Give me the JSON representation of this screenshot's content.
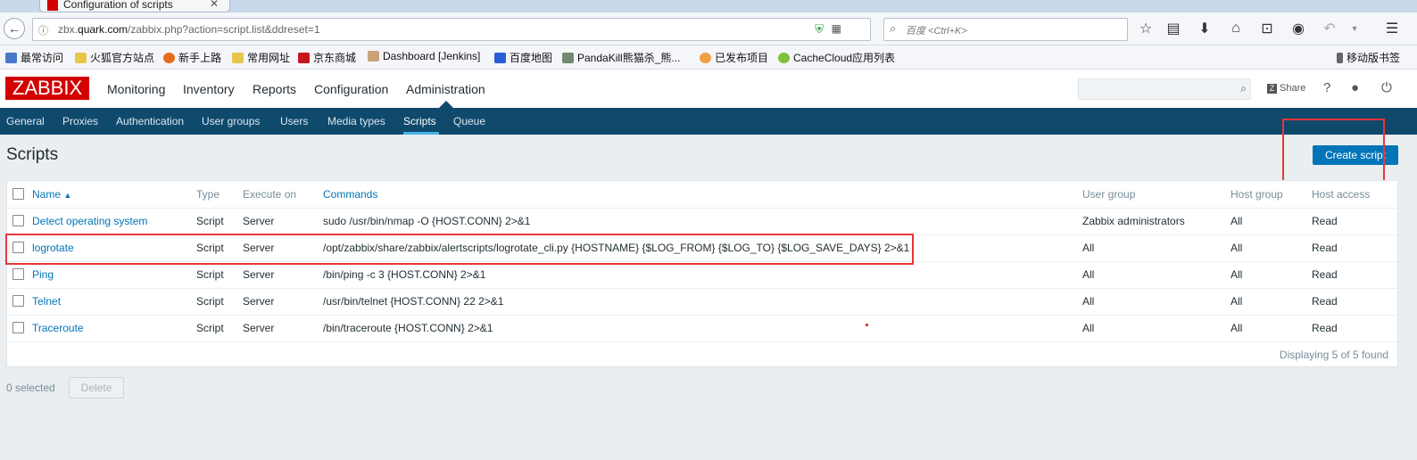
{
  "browser": {
    "tab_title": "Configuration of scripts",
    "url_domain": "zbx.quark.com",
    "url_prefix": "zbx.",
    "url_host": "quark.com",
    "url_path": "/zabbix.php?action=script.list&ddreset=1",
    "search_placeholder": "百度 <Ctrl+K>",
    "bookmarks": [
      "最常访问",
      "火狐官方站点",
      "新手上路",
      "常用网址",
      "京东商城",
      "Dashboard [Jenkins]",
      "百度地图",
      "PandaKill熊猫杀_熊...",
      "已发布项目",
      "CacheCloud应用列表",
      "移动版书签"
    ]
  },
  "zabbix": {
    "logo": "ZABBIX",
    "main_nav": [
      "Monitoring",
      "Inventory",
      "Reports",
      "Configuration",
      "Administration"
    ],
    "share_label": "Share",
    "sub_nav": [
      "General",
      "Proxies",
      "Authentication",
      "User groups",
      "Users",
      "Media types",
      "Scripts",
      "Queue"
    ],
    "active_sub": "Scripts"
  },
  "page": {
    "title": "Scripts",
    "create_button": "Create script",
    "table": {
      "headers": {
        "name": "Name",
        "sort_arrow": "▲",
        "type": "Type",
        "execute_on": "Execute on",
        "commands": "Commands",
        "user_group": "User group",
        "host_group": "Host group",
        "host_access": "Host access"
      },
      "rows": [
        {
          "name": "Detect operating system",
          "type": "Script",
          "execute_on": "Server",
          "commands": "sudo /usr/bin/nmap -O {HOST.CONN} 2>&1",
          "user_group": "Zabbix administrators",
          "host_group": "All",
          "host_access": "Read"
        },
        {
          "name": "logrotate",
          "type": "Script",
          "execute_on": "Server",
          "commands": "/opt/zabbix/share/zabbix/alertscripts/logrotate_cli.py {HOSTNAME} {$LOG_FROM} {$LOG_TO} {$LOG_SAVE_DAYS} 2>&1",
          "user_group": "All",
          "host_group": "All",
          "host_access": "Read"
        },
        {
          "name": "Ping",
          "type": "Script",
          "execute_on": "Server",
          "commands": "/bin/ping -c 3 {HOST.CONN} 2>&1",
          "user_group": "All",
          "host_group": "All",
          "host_access": "Read"
        },
        {
          "name": "Telnet",
          "type": "Script",
          "execute_on": "Server",
          "commands": "/usr/bin/telnet {HOST.CONN} 22 2>&1",
          "user_group": "All",
          "host_group": "All",
          "host_access": "Read"
        },
        {
          "name": "Traceroute",
          "type": "Script",
          "execute_on": "Server",
          "commands": "/bin/traceroute {HOST.CONN} 2>&1",
          "user_group": "All",
          "host_group": "All",
          "host_access": "Read"
        }
      ],
      "footer": "Displaying 5 of 5 found"
    },
    "selected_count": "0 selected",
    "delete_button": "Delete"
  },
  "colors": {
    "brand": "#d40000",
    "subnav": "#0f4a6d",
    "link": "#0275b8",
    "highlight": "#e8363a"
  }
}
